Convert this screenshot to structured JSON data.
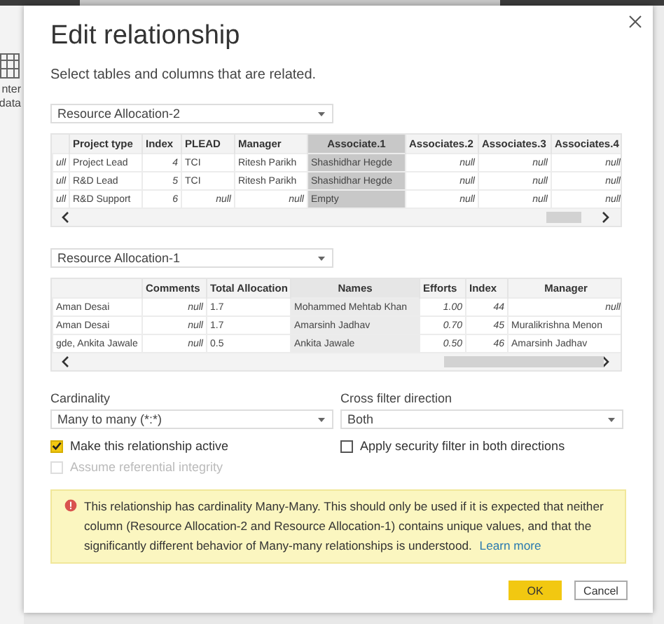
{
  "background_app": {
    "ribbon_labels": [
      "nter",
      "data"
    ]
  },
  "dialog": {
    "title": "Edit relationship",
    "subtitle": "Select tables and columns that are related.",
    "tables": [
      {
        "dropdown": "Resource Allocation-2",
        "columns": [
          {
            "selected": false
          },
          {
            "label": "Project type",
            "selected": false
          },
          {
            "label": "Index",
            "selected": false
          },
          {
            "label": "PLEAD",
            "selected": false
          },
          {
            "label": "Manager",
            "selected": false
          },
          {
            "label": "Associate.1",
            "selected": true
          },
          {
            "label": "Associates.2",
            "selected": false
          },
          {
            "label": "Associates.3",
            "selected": false
          },
          {
            "label": "Associates.4",
            "selected": false
          }
        ],
        "rows": [
          [
            {
              "text": "ull",
              "kind": "null"
            },
            {
              "text": "Project Lead",
              "kind": "text"
            },
            {
              "text": "4",
              "kind": "number"
            },
            {
              "text": "TCI",
              "kind": "text"
            },
            {
              "text": "Ritesh Parikh",
              "kind": "text"
            },
            {
              "text": "Shashidhar Hegde",
              "kind": "text"
            },
            {
              "text": "null",
              "kind": "null"
            },
            {
              "text": "null",
              "kind": "null"
            },
            {
              "text": "null",
              "kind": "null"
            }
          ],
          [
            {
              "text": "ull",
              "kind": "null"
            },
            {
              "text": "R&D Lead",
              "kind": "text"
            },
            {
              "text": "5",
              "kind": "number"
            },
            {
              "text": "TCI",
              "kind": "text"
            },
            {
              "text": "Ritesh Parikh",
              "kind": "text"
            },
            {
              "text": "Shashidhar Hegde",
              "kind": "text"
            },
            {
              "text": "null",
              "kind": "null"
            },
            {
              "text": "null",
              "kind": "null"
            },
            {
              "text": "null",
              "kind": "null"
            }
          ],
          [
            {
              "text": "ull",
              "kind": "null"
            },
            {
              "text": "R&D Support",
              "kind": "text"
            },
            {
              "text": "6",
              "kind": "number"
            },
            {
              "text": "null",
              "kind": "null"
            },
            {
              "text": "null",
              "kind": "null"
            },
            {
              "text": "Empty",
              "kind": "text"
            },
            {
              "text": "null",
              "kind": "null"
            },
            {
              "text": "null",
              "kind": "null"
            },
            {
              "text": "null",
              "kind": "null"
            }
          ]
        ]
      },
      {
        "dropdown": "Resource Allocation-1",
        "columns": [
          {
            "selected": false
          },
          {
            "label": "Comments",
            "selected": false
          },
          {
            "label": "Total Allocation",
            "selected": false
          },
          {
            "label": "Names",
            "selected": true
          },
          {
            "label": "Efforts",
            "selected": false
          },
          {
            "label": "Index",
            "selected": false
          },
          {
            "label": "Manager",
            "selected": false
          }
        ],
        "rows": [
          [
            {
              "text": "Aman Desai",
              "kind": "text"
            },
            {
              "text": "null",
              "kind": "null"
            },
            {
              "text": "1.7",
              "kind": "text"
            },
            {
              "text": "Mohammed Mehtab Khan",
              "kind": "text"
            },
            {
              "text": "1.00",
              "kind": "number"
            },
            {
              "text": "44",
              "kind": "number"
            },
            {
              "text": "null",
              "kind": "null"
            }
          ],
          [
            {
              "text": "Aman Desai",
              "kind": "text"
            },
            {
              "text": "null",
              "kind": "null"
            },
            {
              "text": "1.7",
              "kind": "text"
            },
            {
              "text": "Amarsinh Jadhav",
              "kind": "text"
            },
            {
              "text": "0.70",
              "kind": "number"
            },
            {
              "text": "45",
              "kind": "number"
            },
            {
              "text": "Muralikrishna Menon",
              "kind": "text"
            }
          ],
          [
            {
              "text": "gde, Ankita Jawale",
              "kind": "text"
            },
            {
              "text": "null",
              "kind": "null"
            },
            {
              "text": "0.5",
              "kind": "text"
            },
            {
              "text": "Ankita Jawale",
              "kind": "text"
            },
            {
              "text": "0.50",
              "kind": "number"
            },
            {
              "text": "46",
              "kind": "number"
            },
            {
              "text": "Amarsinh Jadhav",
              "kind": "text"
            }
          ]
        ]
      }
    ],
    "settings": [
      {
        "label": "Cardinality",
        "value": "Many to many (*:*)"
      },
      {
        "label": "Cross filter direction",
        "value": "Both"
      }
    ],
    "checkboxes": [
      {
        "label": "Make this relationship active",
        "checked": true,
        "disabled": false
      },
      {
        "label": "Apply security filter in both directions",
        "checked": false,
        "disabled": false
      },
      {
        "label": "Assume referential integrity",
        "checked": false,
        "disabled": true
      }
    ],
    "warning": {
      "text": "This relationship has cardinality Many-Many. This should only be used if it is expected that neither column (Resource Allocation-2 and Resource Allocation-1) contains unique values, and that the significantly different behavior of Many-many relationships is understood.",
      "link": "Learn more"
    },
    "buttons": [
      {
        "label": "OK",
        "kind": "primary"
      },
      {
        "label": "Cancel",
        "kind": "secondary"
      }
    ]
  }
}
